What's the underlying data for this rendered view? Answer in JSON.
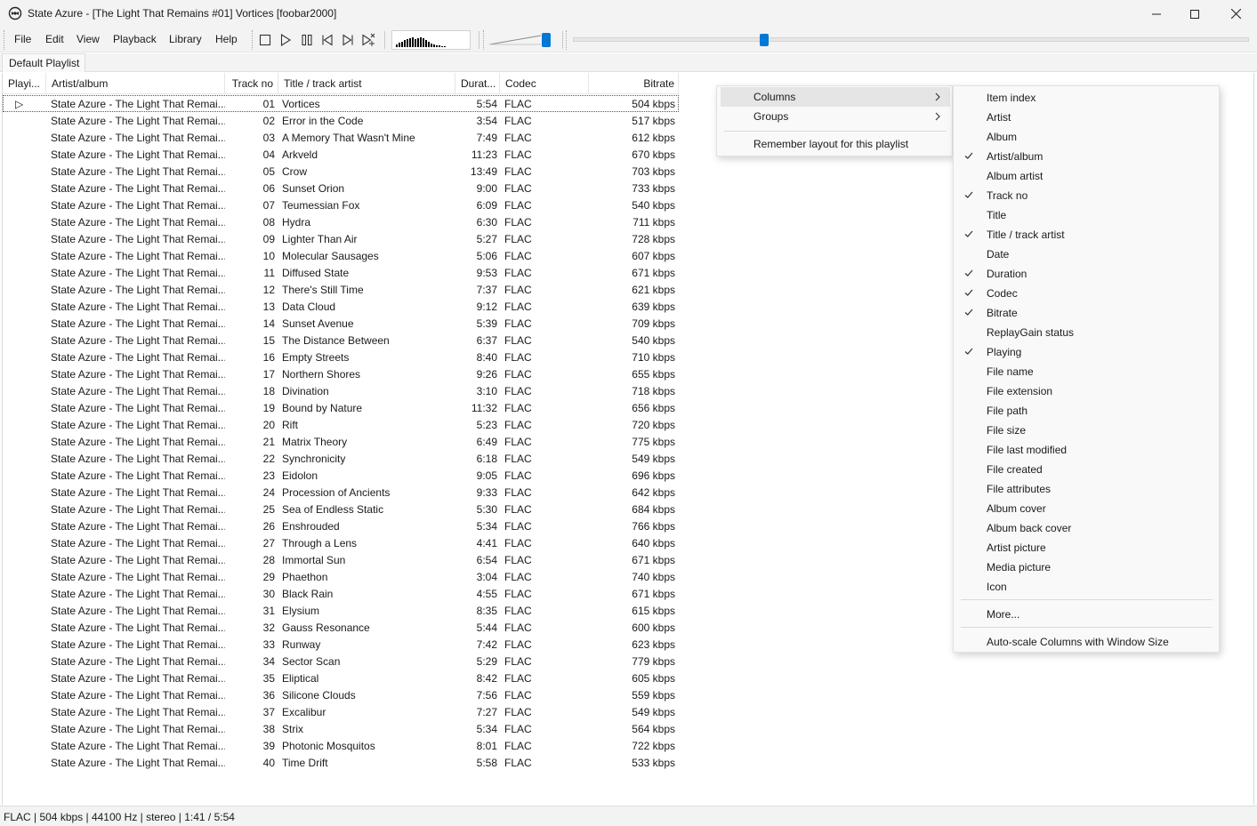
{
  "window": {
    "title": "State Azure - [The Light That Remains #01] Vortices  [foobar2000]",
    "controls": [
      "minimize-icon",
      "maximize-icon",
      "close-icon"
    ]
  },
  "menubar": {
    "items": [
      "File",
      "Edit",
      "View",
      "Playback",
      "Library",
      "Help"
    ]
  },
  "toolbar": {
    "buttons": [
      "stop-icon",
      "play-icon",
      "pause-icon",
      "previous-icon",
      "next-icon",
      "random-icon"
    ],
    "visualizer_bars": [
      3,
      5,
      6,
      8,
      9,
      10,
      11,
      9,
      10,
      11,
      10,
      8,
      6,
      4,
      3,
      2,
      2,
      1,
      1
    ],
    "volume_level": 0.95,
    "seek_position": 0.28
  },
  "playlist_tab": {
    "label": "Default Playlist"
  },
  "columns": {
    "playing": "Playi...",
    "artist_album": "Artist/album",
    "track_no": "Track no",
    "title": "Title / track artist",
    "duration": "Durat...",
    "codec": "Codec",
    "bitrate": "Bitrate"
  },
  "tracks": [
    {
      "playing": "▷",
      "artist": "State Azure - The Light That Remai...",
      "no": "01",
      "title": "Vortices",
      "dur": "5:54",
      "codec": "FLAC",
      "bitrate": "504 kbps"
    },
    {
      "playing": "",
      "artist": "State Azure - The Light That Remai...",
      "no": "02",
      "title": "Error in the Code",
      "dur": "3:54",
      "codec": "FLAC",
      "bitrate": "517 kbps"
    },
    {
      "playing": "",
      "artist": "State Azure - The Light That Remai...",
      "no": "03",
      "title": "A Memory That Wasn't Mine",
      "dur": "7:49",
      "codec": "FLAC",
      "bitrate": "612 kbps"
    },
    {
      "playing": "",
      "artist": "State Azure - The Light That Remai...",
      "no": "04",
      "title": "Arkveld",
      "dur": "11:23",
      "codec": "FLAC",
      "bitrate": "670 kbps"
    },
    {
      "playing": "",
      "artist": "State Azure - The Light That Remai...",
      "no": "05",
      "title": "Crow",
      "dur": "13:49",
      "codec": "FLAC",
      "bitrate": "703 kbps"
    },
    {
      "playing": "",
      "artist": "State Azure - The Light That Remai...",
      "no": "06",
      "title": "Sunset Orion",
      "dur": "9:00",
      "codec": "FLAC",
      "bitrate": "733 kbps"
    },
    {
      "playing": "",
      "artist": "State Azure - The Light That Remai...",
      "no": "07",
      "title": "Teumessian Fox",
      "dur": "6:09",
      "codec": "FLAC",
      "bitrate": "540 kbps"
    },
    {
      "playing": "",
      "artist": "State Azure - The Light That Remai...",
      "no": "08",
      "title": "Hydra",
      "dur": "6:30",
      "codec": "FLAC",
      "bitrate": "711 kbps"
    },
    {
      "playing": "",
      "artist": "State Azure - The Light That Remai...",
      "no": "09",
      "title": "Lighter Than Air",
      "dur": "5:27",
      "codec": "FLAC",
      "bitrate": "728 kbps"
    },
    {
      "playing": "",
      "artist": "State Azure - The Light That Remai...",
      "no": "10",
      "title": "Molecular Sausages",
      "dur": "5:06",
      "codec": "FLAC",
      "bitrate": "607 kbps"
    },
    {
      "playing": "",
      "artist": "State Azure - The Light That Remai...",
      "no": "11",
      "title": "Diffused State",
      "dur": "9:53",
      "codec": "FLAC",
      "bitrate": "671 kbps"
    },
    {
      "playing": "",
      "artist": "State Azure - The Light That Remai...",
      "no": "12",
      "title": "There's Still Time",
      "dur": "7:37",
      "codec": "FLAC",
      "bitrate": "621 kbps"
    },
    {
      "playing": "",
      "artist": "State Azure - The Light That Remai...",
      "no": "13",
      "title": "Data Cloud",
      "dur": "9:12",
      "codec": "FLAC",
      "bitrate": "639 kbps"
    },
    {
      "playing": "",
      "artist": "State Azure - The Light That Remai...",
      "no": "14",
      "title": "Sunset Avenue",
      "dur": "5:39",
      "codec": "FLAC",
      "bitrate": "709 kbps"
    },
    {
      "playing": "",
      "artist": "State Azure - The Light That Remai...",
      "no": "15",
      "title": "The Distance Between",
      "dur": "6:37",
      "codec": "FLAC",
      "bitrate": "540 kbps"
    },
    {
      "playing": "",
      "artist": "State Azure - The Light That Remai...",
      "no": "16",
      "title": "Empty Streets",
      "dur": "8:40",
      "codec": "FLAC",
      "bitrate": "710 kbps"
    },
    {
      "playing": "",
      "artist": "State Azure - The Light That Remai...",
      "no": "17",
      "title": "Northern Shores",
      "dur": "9:26",
      "codec": "FLAC",
      "bitrate": "655 kbps"
    },
    {
      "playing": "",
      "artist": "State Azure - The Light That Remai...",
      "no": "18",
      "title": "Divination",
      "dur": "3:10",
      "codec": "FLAC",
      "bitrate": "718 kbps"
    },
    {
      "playing": "",
      "artist": "State Azure - The Light That Remai...",
      "no": "19",
      "title": "Bound by Nature",
      "dur": "11:32",
      "codec": "FLAC",
      "bitrate": "656 kbps"
    },
    {
      "playing": "",
      "artist": "State Azure - The Light That Remai...",
      "no": "20",
      "title": "Rift",
      "dur": "5:23",
      "codec": "FLAC",
      "bitrate": "720 kbps"
    },
    {
      "playing": "",
      "artist": "State Azure - The Light That Remai...",
      "no": "21",
      "title": "Matrix Theory",
      "dur": "6:49",
      "codec": "FLAC",
      "bitrate": "775 kbps"
    },
    {
      "playing": "",
      "artist": "State Azure - The Light That Remai...",
      "no": "22",
      "title": "Synchronicity",
      "dur": "6:18",
      "codec": "FLAC",
      "bitrate": "549 kbps"
    },
    {
      "playing": "",
      "artist": "State Azure - The Light That Remai...",
      "no": "23",
      "title": "Eidolon",
      "dur": "9:05",
      "codec": "FLAC",
      "bitrate": "696 kbps"
    },
    {
      "playing": "",
      "artist": "State Azure - The Light That Remai...",
      "no": "24",
      "title": "Procession of Ancients",
      "dur": "9:33",
      "codec": "FLAC",
      "bitrate": "642 kbps"
    },
    {
      "playing": "",
      "artist": "State Azure - The Light That Remai...",
      "no": "25",
      "title": "Sea of Endless Static",
      "dur": "5:30",
      "codec": "FLAC",
      "bitrate": "684 kbps"
    },
    {
      "playing": "",
      "artist": "State Azure - The Light That Remai...",
      "no": "26",
      "title": "Enshrouded",
      "dur": "5:34",
      "codec": "FLAC",
      "bitrate": "766 kbps"
    },
    {
      "playing": "",
      "artist": "State Azure - The Light That Remai...",
      "no": "27",
      "title": "Through a Lens",
      "dur": "4:41",
      "codec": "FLAC",
      "bitrate": "640 kbps"
    },
    {
      "playing": "",
      "artist": "State Azure - The Light That Remai...",
      "no": "28",
      "title": "Immortal Sun",
      "dur": "6:54",
      "codec": "FLAC",
      "bitrate": "671 kbps"
    },
    {
      "playing": "",
      "artist": "State Azure - The Light That Remai...",
      "no": "29",
      "title": "Phaethon",
      "dur": "3:04",
      "codec": "FLAC",
      "bitrate": "740 kbps"
    },
    {
      "playing": "",
      "artist": "State Azure - The Light That Remai...",
      "no": "30",
      "title": "Black Rain",
      "dur": "4:55",
      "codec": "FLAC",
      "bitrate": "671 kbps"
    },
    {
      "playing": "",
      "artist": "State Azure - The Light That Remai...",
      "no": "31",
      "title": "Elysium",
      "dur": "8:35",
      "codec": "FLAC",
      "bitrate": "615 kbps"
    },
    {
      "playing": "",
      "artist": "State Azure - The Light That Remai...",
      "no": "32",
      "title": "Gauss Resonance",
      "dur": "5:44",
      "codec": "FLAC",
      "bitrate": "600 kbps"
    },
    {
      "playing": "",
      "artist": "State Azure - The Light That Remai...",
      "no": "33",
      "title": "Runway",
      "dur": "7:42",
      "codec": "FLAC",
      "bitrate": "623 kbps"
    },
    {
      "playing": "",
      "artist": "State Azure - The Light That Remai...",
      "no": "34",
      "title": "Sector Scan",
      "dur": "5:29",
      "codec": "FLAC",
      "bitrate": "779 kbps"
    },
    {
      "playing": "",
      "artist": "State Azure - The Light That Remai...",
      "no": "35",
      "title": "Eliptical",
      "dur": "8:42",
      "codec": "FLAC",
      "bitrate": "605 kbps"
    },
    {
      "playing": "",
      "artist": "State Azure - The Light That Remai...",
      "no": "36",
      "title": "Silicone Clouds",
      "dur": "7:56",
      "codec": "FLAC",
      "bitrate": "559 kbps"
    },
    {
      "playing": "",
      "artist": "State Azure - The Light That Remai...",
      "no": "37",
      "title": "Excalibur",
      "dur": "7:27",
      "codec": "FLAC",
      "bitrate": "549 kbps"
    },
    {
      "playing": "",
      "artist": "State Azure - The Light That Remai...",
      "no": "38",
      "title": "Strix",
      "dur": "5:34",
      "codec": "FLAC",
      "bitrate": "564 kbps"
    },
    {
      "playing": "",
      "artist": "State Azure - The Light That Remai...",
      "no": "39",
      "title": "Photonic Mosquitos",
      "dur": "8:01",
      "codec": "FLAC",
      "bitrate": "722 kbps"
    },
    {
      "playing": "",
      "artist": "State Azure - The Light That Remai...",
      "no": "40",
      "title": "Time Drift",
      "dur": "5:58",
      "codec": "FLAC",
      "bitrate": "533 kbps"
    }
  ],
  "statusbar": {
    "text": "FLAC | 504 kbps | 44100 Hz | stereo | 1:41 / 5:54"
  },
  "context_menu": {
    "items": [
      {
        "label": "Columns",
        "submenu": true
      },
      {
        "label": "Groups",
        "submenu": true
      },
      {
        "label": "Remember layout for this playlist",
        "submenu": false
      }
    ]
  },
  "columns_submenu": {
    "items": [
      {
        "label": "Item index",
        "checked": false
      },
      {
        "label": "Artist",
        "checked": false
      },
      {
        "label": "Album",
        "checked": false
      },
      {
        "label": "Artist/album",
        "checked": true
      },
      {
        "label": "Album artist",
        "checked": false
      },
      {
        "label": "Track no",
        "checked": true
      },
      {
        "label": "Title",
        "checked": false
      },
      {
        "label": "Title / track artist",
        "checked": true
      },
      {
        "label": "Date",
        "checked": false
      },
      {
        "label": "Duration",
        "checked": true
      },
      {
        "label": "Codec",
        "checked": true
      },
      {
        "label": "Bitrate",
        "checked": true
      },
      {
        "label": "ReplayGain status",
        "checked": false
      },
      {
        "label": "Playing",
        "checked": true
      },
      {
        "label": "File name",
        "checked": false
      },
      {
        "label": "File extension",
        "checked": false
      },
      {
        "label": "File path",
        "checked": false
      },
      {
        "label": "File size",
        "checked": false
      },
      {
        "label": "File last modified",
        "checked": false
      },
      {
        "label": "File created",
        "checked": false
      },
      {
        "label": "File attributes",
        "checked": false
      },
      {
        "label": "Album cover",
        "checked": false
      },
      {
        "label": "Album back cover",
        "checked": false
      },
      {
        "label": "Artist picture",
        "checked": false
      },
      {
        "label": "Media picture",
        "checked": false
      },
      {
        "label": "Icon",
        "checked": false
      }
    ],
    "more_label": "More...",
    "autoscale_label": "Auto-scale Columns with Window Size"
  },
  "colors": {
    "accent": "#0078d4",
    "chrome": "#f3f3f3",
    "menu_bg": "#f9f9f9",
    "menu_highlight": "#e5e5e5"
  }
}
